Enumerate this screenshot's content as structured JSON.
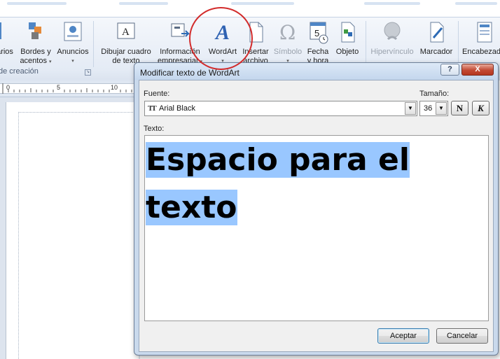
{
  "ribbon": {
    "buttons": {
      "partial_left": {
        "label": "arios",
        "caret": ""
      },
      "borders": {
        "label1": "Bordes y",
        "label2": "acentos",
        "caret": "▾"
      },
      "ads": {
        "label1": "Anuncios",
        "caret": "▾"
      },
      "draw_textbox": {
        "label1": "Dibujar cuadro",
        "label2": "de texto"
      },
      "business_info": {
        "label1": "Información",
        "label2": "empresarial",
        "caret": "▾"
      },
      "wordart": {
        "label1": "WordArt",
        "caret": "▾"
      },
      "insert_file": {
        "label1": "Insertar",
        "label2": "archivo"
      },
      "symbol": {
        "label1": "Símbolo",
        "caret": "▾"
      },
      "date_time": {
        "label1": "Fecha",
        "label2": "y hora"
      },
      "object": {
        "label1": "Objeto"
      },
      "hyperlink": {
        "label1": "Hipervínculo"
      },
      "bookmark": {
        "label1": "Marcador"
      },
      "header": {
        "label1": "Encabezad"
      }
    },
    "group_label": "de creación"
  },
  "ruler": {
    "labels": [
      "0",
      "5",
      "10"
    ]
  },
  "dialog": {
    "title": "Modificar texto de WordArt",
    "help_label": "?",
    "close_label": "X",
    "font_label": "Fuente:",
    "font_value": "Arial Black",
    "size_label": "Tamaño:",
    "size_value": "36",
    "bold_label": "N",
    "italic_label": "K",
    "text_label": "Texto:",
    "text_line1": "Espacio para el",
    "text_line2": "texto",
    "accept_label": "Aceptar",
    "cancel_label": "Cancelar"
  },
  "colors": {
    "highlight_circle": "#d22b2b",
    "text_selection": "#99c7ff",
    "close_button": "#c24a34"
  }
}
